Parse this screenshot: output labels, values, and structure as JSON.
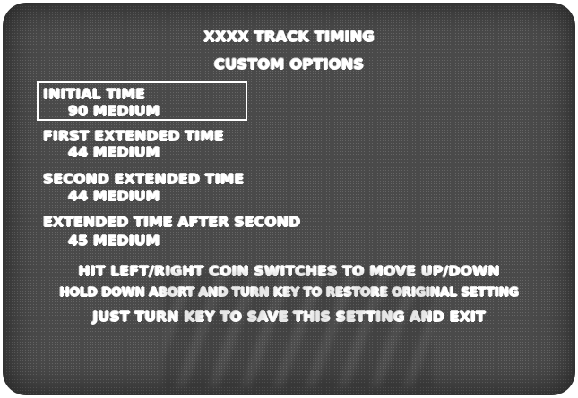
{
  "header": {
    "title": "XXXX TRACK TIMING",
    "subtitle": "CUSTOM OPTIONS"
  },
  "options": [
    {
      "label": "INITIAL TIME",
      "value": "90 MEDIUM",
      "selected": true
    },
    {
      "label": "FIRST EXTENDED TIME",
      "value": "44 MEDIUM",
      "selected": false
    },
    {
      "label": "SECOND EXTENDED TIME",
      "value": "44 MEDIUM",
      "selected": false
    },
    {
      "label": "EXTENDED TIME AFTER SECOND",
      "value": "45 MEDIUM",
      "selected": false
    }
  ],
  "instructions": {
    "line1": "HIT LEFT/RIGHT COIN SWITCHES TO MOVE UP/DOWN",
    "line2": "HOLD DOWN ABORT AND TURN KEY TO RESTORE ORIGINAL SETTING",
    "line3": "JUST TURN KEY TO SAVE THIS SETTING AND EXIT"
  },
  "colors": {
    "screen_background": "#2b2b2b",
    "text": "#ffffff"
  }
}
